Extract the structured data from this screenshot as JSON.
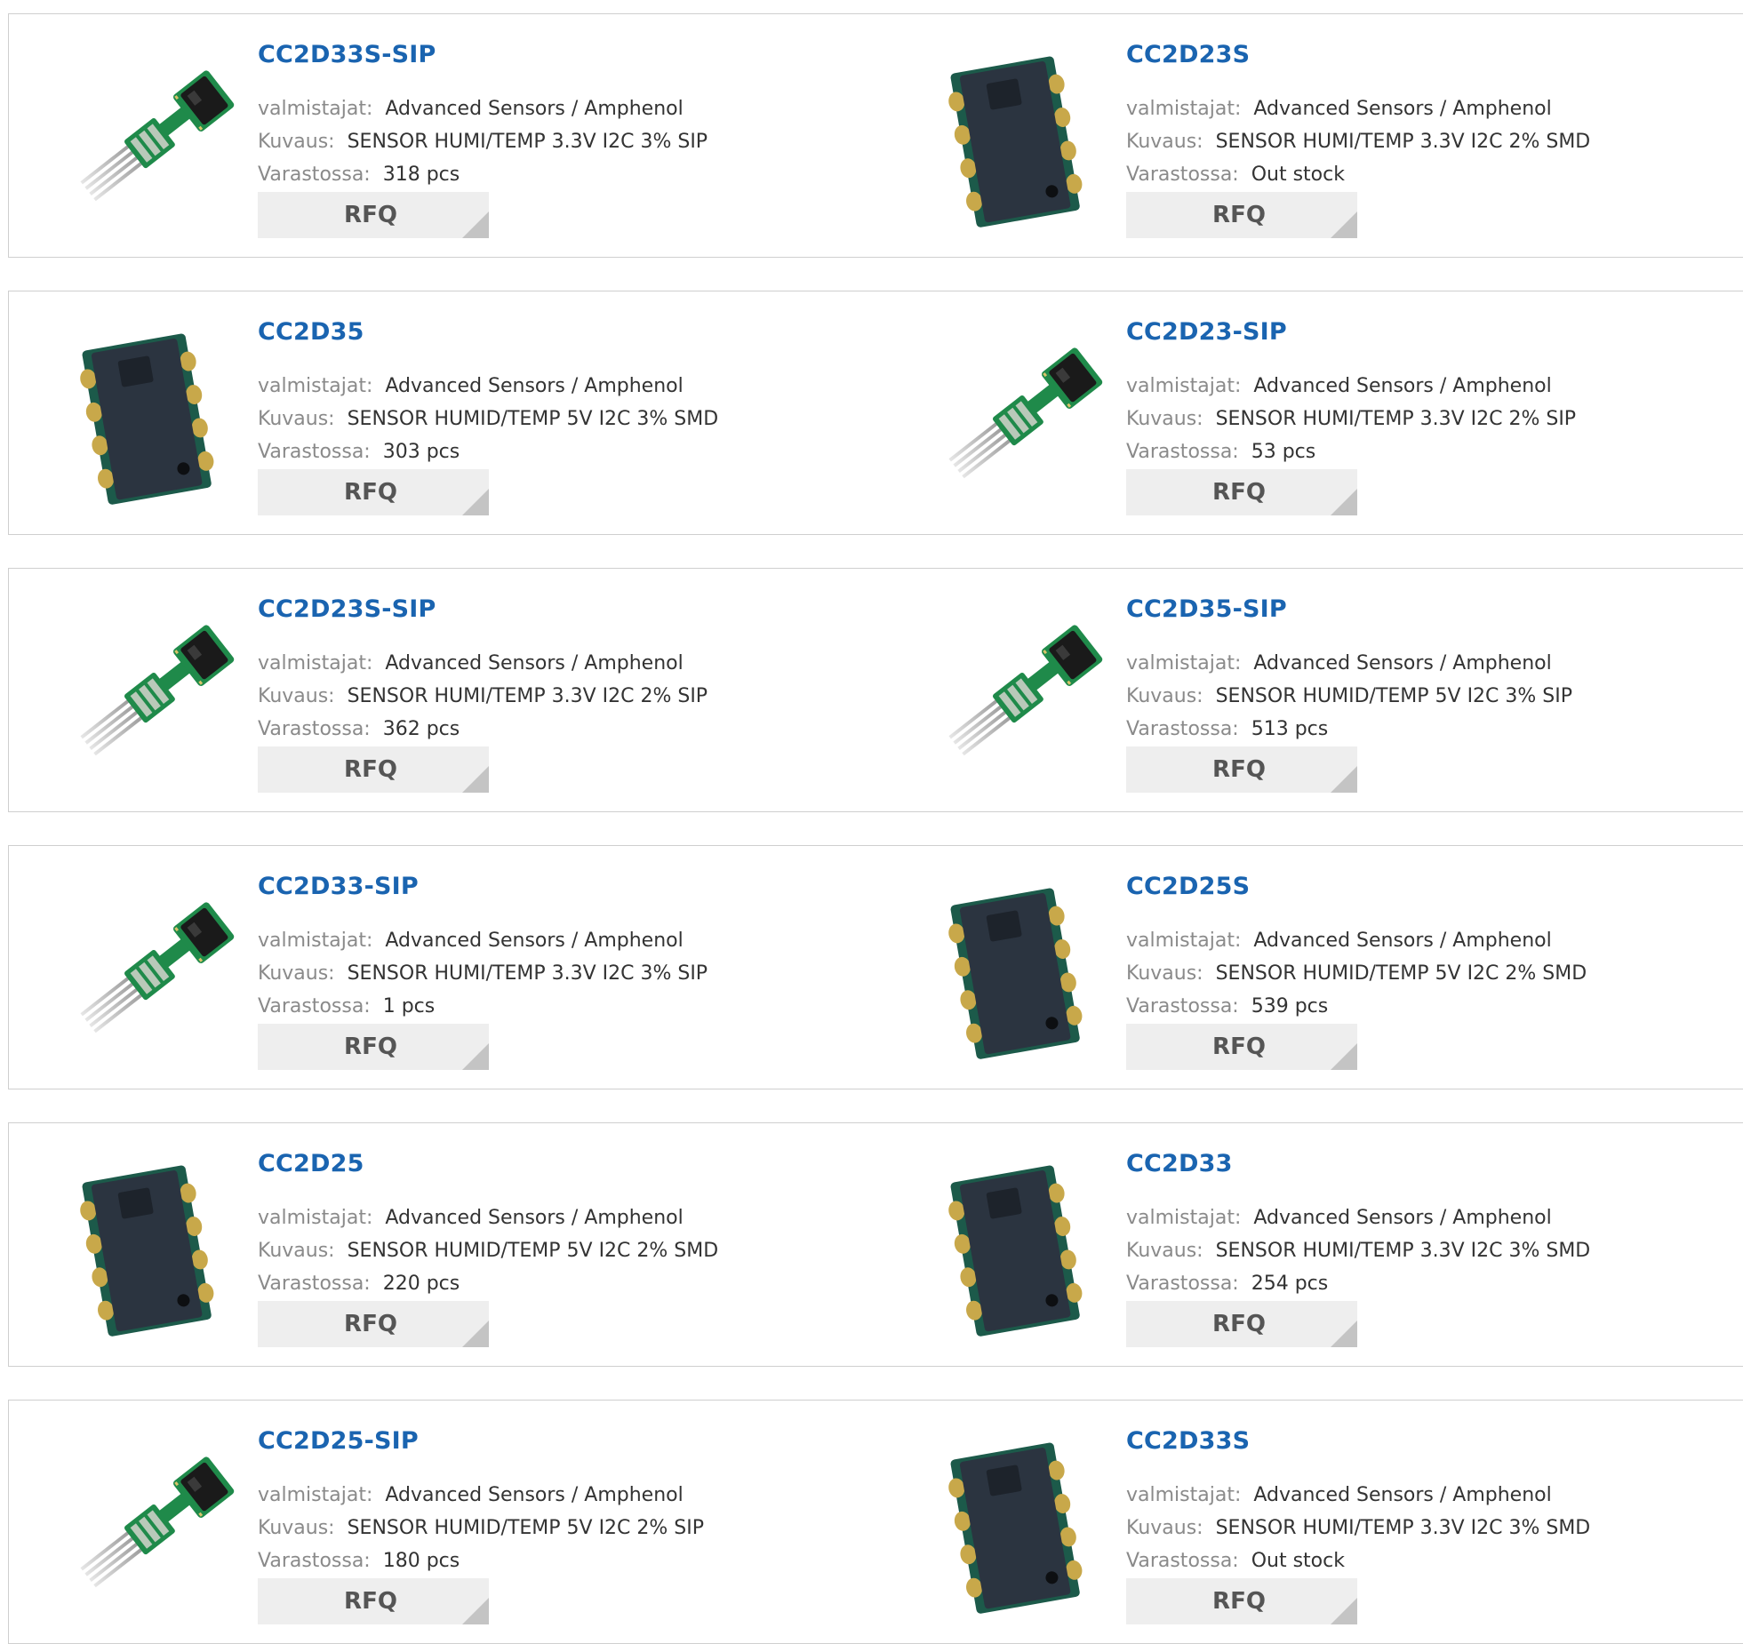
{
  "labels": {
    "manufacturer": "valmistajat:",
    "description": "Kuvaus:",
    "stock": "Varastossa:",
    "rfq": "RFQ"
  },
  "products": [
    {
      "name": "CC2D33S-SIP",
      "manufacturer": "Advanced Sensors / Amphenol",
      "description": "SENSOR HUMI/TEMP 3.3V I2C 3% SIP",
      "stock": "318 pcs",
      "image": "sip-sensor-image"
    },
    {
      "name": "CC2D23S",
      "manufacturer": "Advanced Sensors / Amphenol",
      "description": "SENSOR HUMI/TEMP 3.3V I2C 2% SMD",
      "stock": "Out stock",
      "image": "smd-sensor-image"
    },
    {
      "name": "CC2D35",
      "manufacturer": "Advanced Sensors / Amphenol",
      "description": "SENSOR HUMID/TEMP 5V I2C 3% SMD",
      "stock": "303 pcs",
      "image": "smd-sensor-image"
    },
    {
      "name": "CC2D23-SIP",
      "manufacturer": "Advanced Sensors / Amphenol",
      "description": "SENSOR HUMI/TEMP 3.3V I2C 2% SIP",
      "stock": "53 pcs",
      "image": "sip-sensor-image"
    },
    {
      "name": "CC2D23S-SIP",
      "manufacturer": "Advanced Sensors / Amphenol",
      "description": "SENSOR HUMI/TEMP 3.3V I2C 2% SIP",
      "stock": "362 pcs",
      "image": "sip-sensor-image"
    },
    {
      "name": "CC2D35-SIP",
      "manufacturer": "Advanced Sensors / Amphenol",
      "description": "SENSOR HUMID/TEMP 5V I2C 3% SIP",
      "stock": "513 pcs",
      "image": "sip-sensor-image"
    },
    {
      "name": "CC2D33-SIP",
      "manufacturer": "Advanced Sensors / Amphenol",
      "description": "SENSOR HUMI/TEMP 3.3V I2C 3% SIP",
      "stock": "1 pcs",
      "image": "sip-sensor-image"
    },
    {
      "name": "CC2D25S",
      "manufacturer": "Advanced Sensors / Amphenol",
      "description": "SENSOR HUMID/TEMP 5V I2C 2% SMD",
      "stock": "539 pcs",
      "image": "smd-sensor-image"
    },
    {
      "name": "CC2D25",
      "manufacturer": "Advanced Sensors / Amphenol",
      "description": "SENSOR HUMID/TEMP 5V I2C 2% SMD",
      "stock": "220 pcs",
      "image": "smd-sensor-image"
    },
    {
      "name": "CC2D33",
      "manufacturer": "Advanced Sensors / Amphenol",
      "description": "SENSOR HUMI/TEMP 3.3V I2C 3% SMD",
      "stock": "254 pcs",
      "image": "smd-sensor-image"
    },
    {
      "name": "CC2D25-SIP",
      "manufacturer": "Advanced Sensors / Amphenol",
      "description": "SENSOR HUMID/TEMP 5V I2C 2% SIP",
      "stock": "180 pcs",
      "image": "sip-sensor-image"
    },
    {
      "name": "CC2D33S",
      "manufacturer": "Advanced Sensors / Amphenol",
      "description": "SENSOR HUMI/TEMP 3.3V I2C 3% SMD",
      "stock": "Out stock",
      "image": "smd-sensor-image"
    }
  ]
}
